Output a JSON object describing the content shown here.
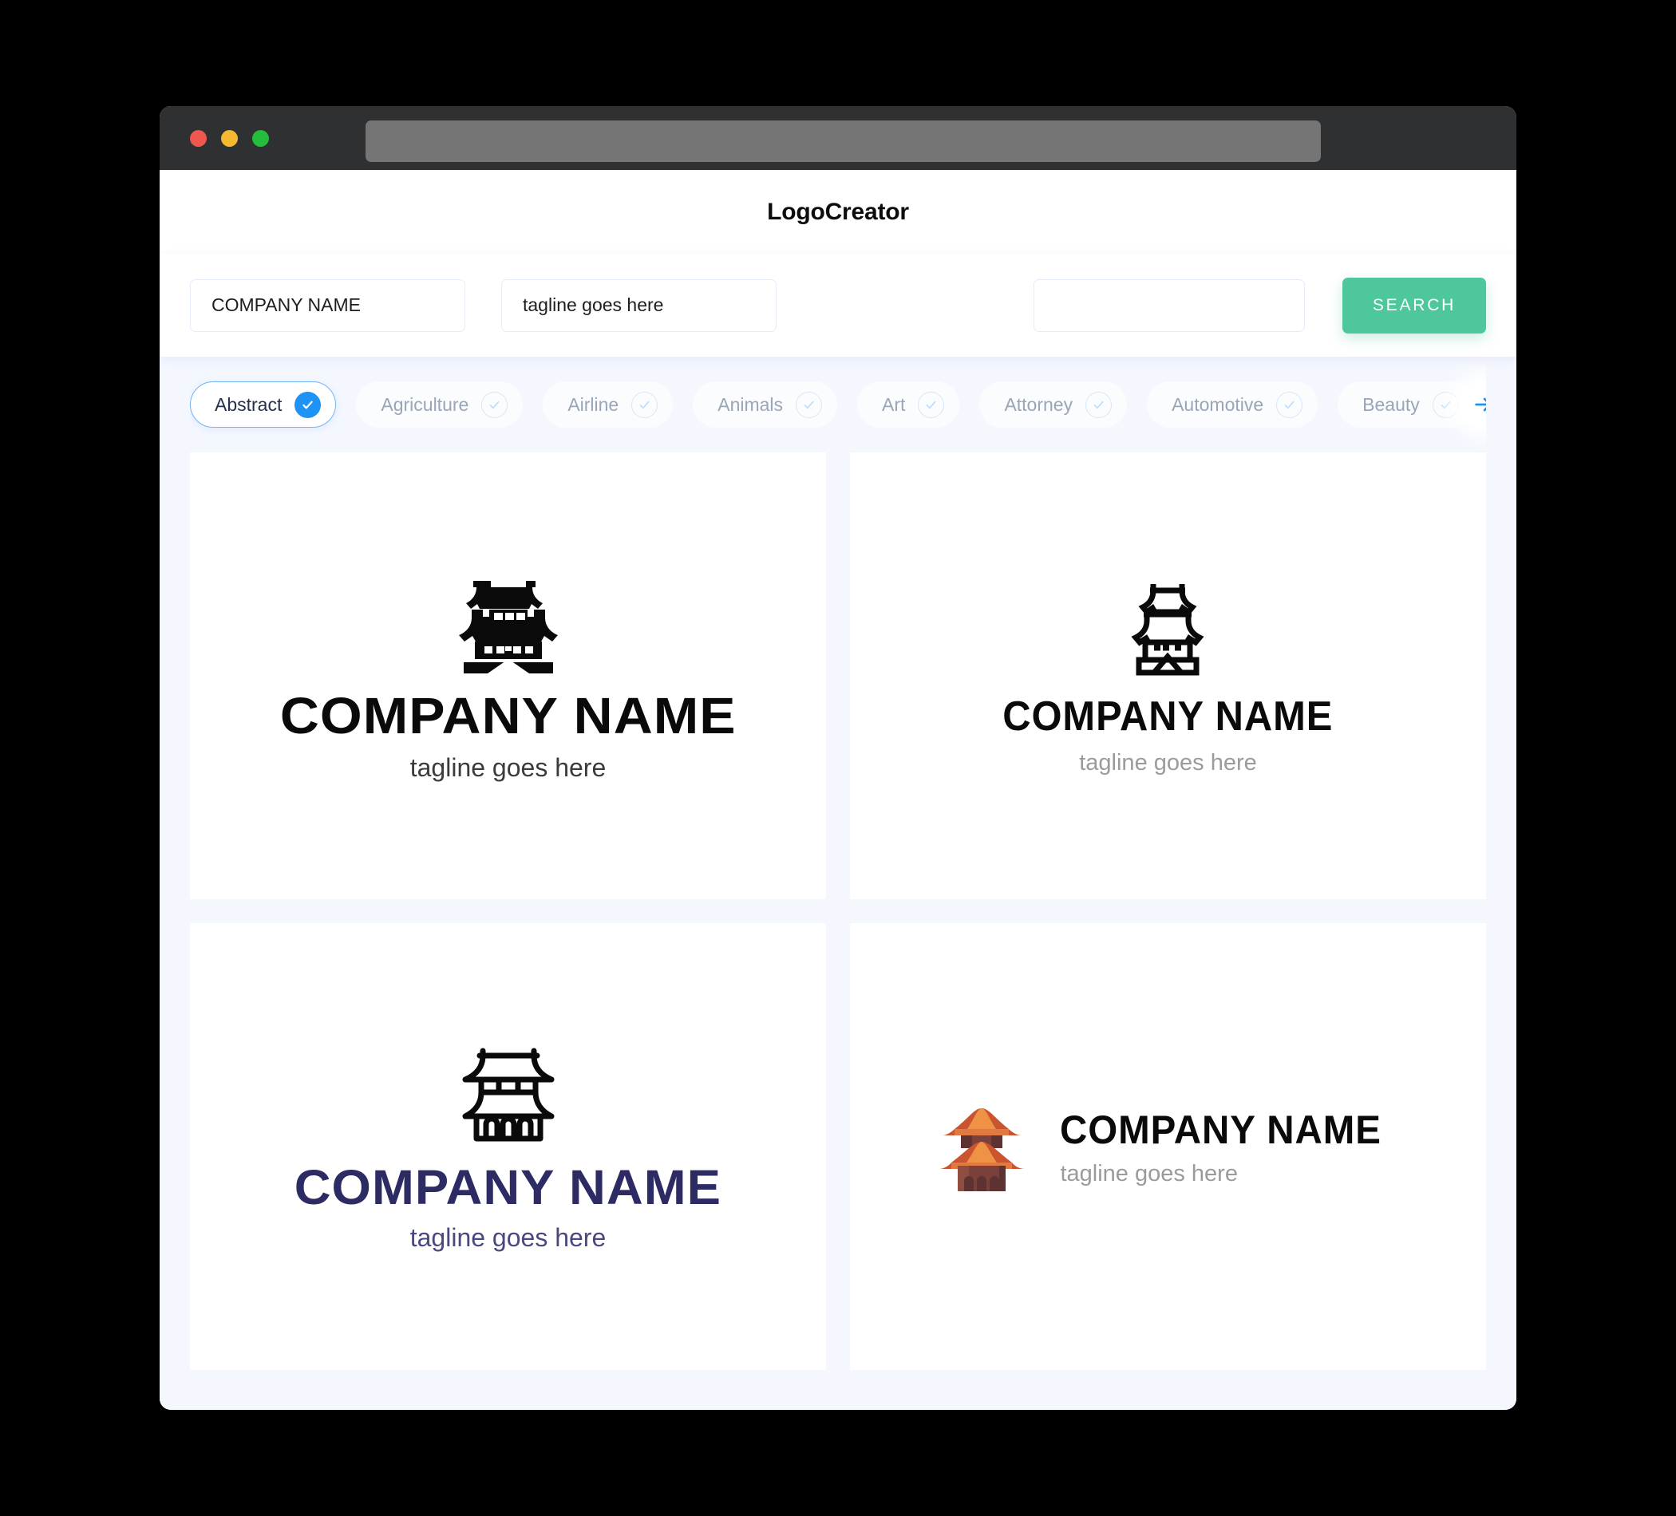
{
  "window": {
    "traffic_lights": [
      "close",
      "minimize",
      "maximize"
    ],
    "url_value": ""
  },
  "header": {
    "title": "LogoCreator"
  },
  "search": {
    "company_value": "COMPANY NAME",
    "company_placeholder": "COMPANY NAME",
    "tagline_value": "tagline goes here",
    "tagline_placeholder": "tagline goes here",
    "keyword_value": "",
    "keyword_placeholder": "",
    "button_label": "SEARCH",
    "button_color": "#4EC79D"
  },
  "categories": {
    "accent_color": "#1F92F5",
    "items": [
      {
        "label": "Abstract",
        "selected": true
      },
      {
        "label": "Agriculture",
        "selected": false
      },
      {
        "label": "Airline",
        "selected": false
      },
      {
        "label": "Animals",
        "selected": false
      },
      {
        "label": "Art",
        "selected": false
      },
      {
        "label": "Attorney",
        "selected": false
      },
      {
        "label": "Automotive",
        "selected": false
      },
      {
        "label": "Beauty",
        "selected": false
      }
    ],
    "next_icon": "arrow-right-icon"
  },
  "results": {
    "cards": [
      {
        "icon": "pagoda-solid-icon",
        "name": "COMPANY NAME",
        "tagline": "tagline goes here",
        "name_color": "#0A0A0A",
        "tagline_color": "#3B3B3B"
      },
      {
        "icon": "pagoda-outline-icon",
        "name": "COMPANY NAME",
        "tagline": "tagline goes here",
        "name_color": "#0A0A0A",
        "tagline_color": "#9B9B9B"
      },
      {
        "icon": "temple-outline-icon",
        "name": "COMPANY NAME",
        "tagline": "tagline goes here",
        "name_color": "#2D2B63",
        "tagline_color": "#4A4880"
      },
      {
        "icon": "pagoda-color-icon",
        "name": "COMPANY NAME",
        "tagline": "tagline goes here",
        "name_color": "#0A0A0A",
        "tagline_color": "#9B9B9B"
      }
    ]
  }
}
